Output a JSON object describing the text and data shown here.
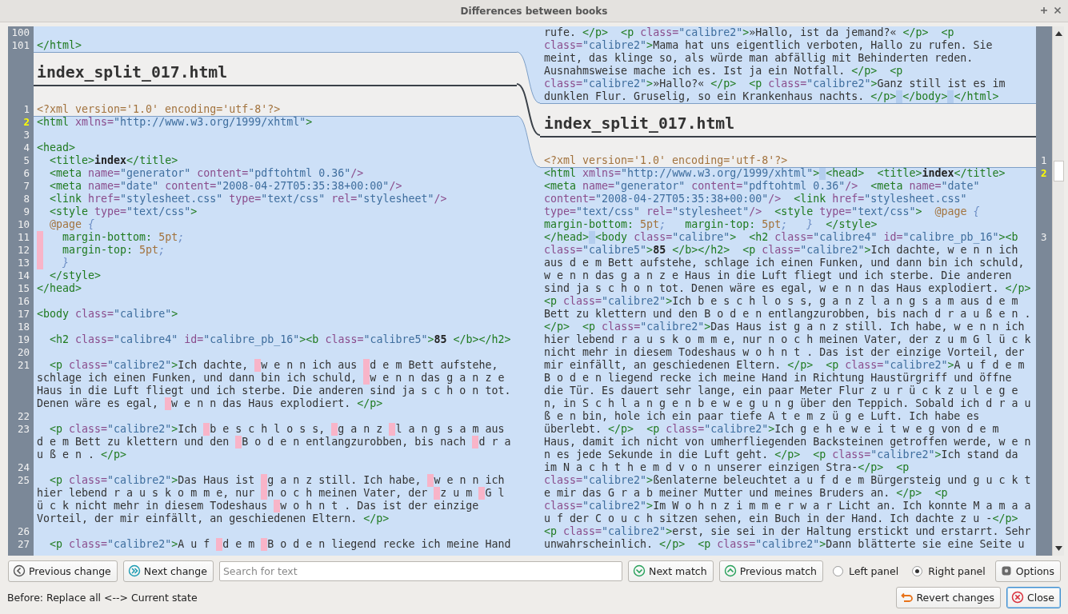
{
  "window": {
    "title": "Differences between books"
  },
  "left_panel": {
    "rows": [
      {
        "kind": "code",
        "number": "100",
        "current": false,
        "in_change": true
      },
      {
        "kind": "code",
        "number": "101",
        "current": false,
        "in_change": true,
        "segments": [
          {
            "text": "</html>",
            "changed": false
          }
        ]
      },
      {
        "kind": "file_header",
        "title": "index_split_017.html"
      },
      {
        "kind": "code",
        "number": "1",
        "current": false,
        "in_change": false,
        "segments": [
          {
            "text": "<?xml version='1.0' encoding='utf-8'?>",
            "changed": false
          }
        ]
      },
      {
        "kind": "code",
        "number": "2",
        "current": true,
        "in_change": true,
        "segments": [
          {
            "text": "<html xmlns=\"http://www.w3.org/1999/xhtml\">",
            "changed": false
          }
        ]
      },
      {
        "kind": "code",
        "number": "3",
        "current": false,
        "in_change": true
      },
      {
        "kind": "code",
        "number": "4",
        "current": false,
        "in_change": true,
        "segments": [
          {
            "text": "<head>",
            "changed": false
          }
        ]
      },
      {
        "kind": "code",
        "number": "5",
        "current": false,
        "in_change": true,
        "segments": [
          {
            "text": "  <title>**index**</title>",
            "changed": false
          }
        ]
      },
      {
        "kind": "code",
        "number": "6",
        "current": false,
        "in_change": true,
        "segments": [
          {
            "text": "  <meta name=\"generator\" content=\"pdftohtml 0.36\"/>",
            "changed": false
          }
        ]
      },
      {
        "kind": "code",
        "number": "7",
        "current": false,
        "in_change": true,
        "segments": [
          {
            "text": "  <meta name=\"date\" content=\"2008-04-27T05:35:38+00:00\"/>",
            "changed": false
          }
        ]
      },
      {
        "kind": "code",
        "number": "8",
        "current": false,
        "in_change": true,
        "segments": [
          {
            "text": "  <link href=\"stylesheet.css\" type=\"text/css\" rel=\"stylesheet\"/>",
            "changed": false
          }
        ]
      },
      {
        "kind": "code",
        "number": "9",
        "current": false,
        "in_change": true,
        "segments": [
          {
            "text": "  <style type=\"text/css\">",
            "changed": false
          }
        ]
      },
      {
        "kind": "code",
        "number": "10",
        "current": false,
        "in_change": true,
        "segments": [
          {
            "text": "  @page {",
            "changed": false
          }
        ]
      },
      {
        "kind": "code",
        "number": "11",
        "current": false,
        "in_change": true,
        "segments": [
          {
            "changed": true
          },
          {
            "text": "   margin-bottom: 5pt;",
            "changed": false
          }
        ]
      },
      {
        "kind": "code",
        "number": "12",
        "current": false,
        "in_change": true,
        "segments": [
          {
            "changed": true
          },
          {
            "text": "   margin-top: 5pt;",
            "changed": false
          }
        ]
      },
      {
        "kind": "code",
        "number": "13",
        "current": false,
        "in_change": true,
        "segments": [
          {
            "changed": true
          },
          {
            "text": "   }",
            "changed": false
          }
        ]
      },
      {
        "kind": "code",
        "number": "14",
        "current": false,
        "in_change": true,
        "segments": [
          {
            "text": "  </style>",
            "changed": false
          }
        ]
      },
      {
        "kind": "code",
        "number": "15",
        "current": false,
        "in_change": true,
        "segments": [
          {
            "text": "</head>",
            "changed": false
          }
        ]
      },
      {
        "kind": "code",
        "number": "16",
        "current": false,
        "in_change": true
      },
      {
        "kind": "code",
        "number": "17",
        "current": false,
        "in_change": true,
        "segments": [
          {
            "text": "<body class=\"calibre\">",
            "changed": false
          }
        ]
      },
      {
        "kind": "code",
        "number": "18",
        "current": false,
        "in_change": true
      },
      {
        "kind": "code",
        "number": "19",
        "current": false,
        "in_change": true,
        "segments": [
          {
            "text": "  <h2 class=\"calibre4\" id=\"calibre_pb_16\"><b class=\"calibre5\">**85** </b></h2>",
            "changed": false
          }
        ]
      },
      {
        "kind": "code",
        "number": "20",
        "current": false,
        "in_change": true
      },
      {
        "kind": "code",
        "number": "21",
        "current": false,
        "in_change": true,
        "segments": [
          {
            "text": "  <p class=\"calibre2\">Ich dachte, ",
            "changed": false
          },
          {
            "changed": true
          },
          {
            "text": "w e n n ich aus ",
            "changed": false
          },
          {
            "changed": true
          },
          {
            "text": "d e m Bett aufstehe, schlage ich einen Funken, und dann bin ich schuld, ",
            "changed": false
          },
          {
            "changed": true
          },
          {
            "text": "w e n n das g a n z e Haus in die Luft fliegt und ich sterbe. Die anderen sind ja s c h o n tot. Denen wäre es egal, ",
            "changed": false
          },
          {
            "changed": true
          },
          {
            "text": "w e n n das Haus explodiert. </p>",
            "changed": false
          }
        ]
      },
      {
        "kind": "code",
        "number": "22",
        "current": false,
        "in_change": true
      },
      {
        "kind": "code",
        "number": "23",
        "current": false,
        "in_change": true,
        "segments": [
          {
            "text": "  <p class=\"calibre2\">Ich ",
            "changed": false
          },
          {
            "changed": true
          },
          {
            "text": "b e s c h l o s s, ",
            "changed": false
          },
          {
            "changed": true
          },
          {
            "text": "g a n z ",
            "changed": false
          },
          {
            "changed": true
          },
          {
            "text": "l a n g s a m aus d e m Bett zu klettern und den ",
            "changed": false
          },
          {
            "changed": true
          },
          {
            "text": "B o d e n entlangzurobben, bis nach ",
            "changed": false
          },
          {
            "changed": true
          },
          {
            "text": "d r a ",
            "changed": false
          },
          {
            "text": "u ß e n . </p>",
            "changed": false
          }
        ]
      },
      {
        "kind": "code",
        "number": "24",
        "current": false,
        "in_change": true
      },
      {
        "kind": "code",
        "number": "25",
        "current": false,
        "in_change": true,
        "segments": [
          {
            "text": "  <p class=\"calibre2\">Das Haus ist ",
            "changed": false
          },
          {
            "changed": true
          },
          {
            "text": "g a n z still. Ich habe, ",
            "changed": false
          },
          {
            "changed": true
          },
          {
            "text": "w e n n ich hier lebend r a u s k o m m e, nur ",
            "changed": false
          },
          {
            "changed": true
          },
          {
            "text": "n o c h meinen Vater, der ",
            "changed": false
          },
          {
            "changed": true
          },
          {
            "text": "z u m ",
            "changed": false
          },
          {
            "changed": true
          },
          {
            "text": "G l ü c k nicht mehr in diesem Todeshaus ",
            "changed": false
          },
          {
            "changed": true
          },
          {
            "text": "w o h n t . Das ist der einzige Vorteil, der mir einfällt, an geschiedenen Eltern. </p>",
            "changed": false
          }
        ]
      },
      {
        "kind": "code",
        "number": "26",
        "current": false,
        "in_change": true
      },
      {
        "kind": "code",
        "number": "27",
        "current": false,
        "in_change": true,
        "segments": [
          {
            "text": "  <p class=\"calibre2\">A u f ",
            "changed": false
          },
          {
            "changed": true
          },
          {
            "text": "d e m ",
            "changed": false
          },
          {
            "changed": true
          },
          {
            "text": "B o d e n liegend recke ich meine Hand",
            "changed": false
          }
        ]
      }
    ]
  },
  "right_panel": {
    "rows": [
      {
        "kind": "code",
        "in_change": true,
        "segments": [
          {
            "text": "rufe. </p>  <p class=\"calibre2\">»Hallo, ist da jemand?« </p>  <p class=\"calibre2\">Mama hat uns eigentlich verboten, Hallo zu rufen. Sie meint, das klinge so, als würde man abfällig mit Behinderten reden. Ausnahmsweise mache ich es. Ist ja ein Notfall. </p>  <p class=\"calibre2\">»Hallo?« </p>  <p class=\"calibre2\">Ganz still ist es im dunklen Flur. Gruselig, so ein Krankenhaus nachts. </p>",
            "changed": false
          },
          {
            "changed": true
          },
          {
            "text": "</body>",
            "changed": false
          },
          {
            "changed": true
          },
          {
            "text": "</html>",
            "changed": false
          }
        ]
      },
      {
        "kind": "file_header",
        "title": "index_split_017.html"
      },
      {
        "kind": "code",
        "number": "1",
        "current": false,
        "in_change": false,
        "segments": [
          {
            "text": "<?xml version='1.0' encoding='utf-8'?>",
            "changed": false
          }
        ]
      },
      {
        "kind": "code",
        "number": "2",
        "current": true,
        "in_change": true,
        "segments": [
          {
            "text": "<html xmlns=\"http://www.w3.org/1999/xhtml\">",
            "changed": false
          },
          {
            "changed": true
          },
          {
            "text": "<head>  <title>**index**</title>  <meta name=\"generator\" content=\"pdftohtml 0.36\"/>  <meta name=\"date\" content=\"2008-04-27T05:35:38+00:00\"/>  <link href=\"stylesheet.css\" type=\"text/css\" rel=\"stylesheet\"/>  <style type=\"text/css\">  @page {   margin-bottom: 5pt;   margin-top: 5pt;   }  </style>",
            "changed": false
          }
        ]
      },
      {
        "kind": "code",
        "number": "3",
        "current": false,
        "in_change": true,
        "segments": [
          {
            "text": "</head>",
            "changed": false
          },
          {
            "changed": true
          },
          {
            "text": "<body class=\"calibre\">  <h2 class=\"calibre4\" id=\"calibre_pb_16\"><b class=\"calibre5\">**85** </b></h2>  <p class=\"calibre2\">Ich dachte, w e n n ich aus d e m Bett aufstehe, schlage ich einen Funken, und dann bin ich schuld, w e n n das g a n z e Haus in die Luft fliegt und ich sterbe. Die anderen sind ja s c h o n tot. Denen wäre es egal, w e n n das Haus explodiert. </p>  <p class=\"calibre2\">Ich b e s c h l o s s, g a n z l a n g s a m aus d e m Bett zu klettern und den B o d e n entlangzurobben, bis nach d r a u ß e n . </p>  <p class=\"calibre2\">Das Haus ist g a n z still. Ich habe, w e n n ich hier lebend r a u s k o m m e, nur n o c h meinen Vater, der z u m G l ü c k nicht mehr in diesem Todeshaus w o h n t . Das ist der einzige Vorteil, der mir einfällt, an geschiedenen Eltern. </p>  <p class=\"calibre2\">A u f d e m B o d e n liegend recke ich meine Hand in Richtung Haustürgriff und öffne die Tür. Es dauert sehr lange, ein paar Meter Flur z u r ü c k z u l e g e n, in S c h l a n g e n b e w e g u n g über den Teppich. Sobald ich d r a u ß e n bin, hole ich ein paar tiefe A t e m z ü g e Luft. Ich habe es überlebt. </p>  <p class=\"calibre2\">Ich g e h e w e i t w e g von d e m Haus, damit ich nicht von umherfliegenden Backsteinen getroffen werde, w e n n es jede Sekunde in die Luft geht. </p>  <p class=\"calibre2\">Ich stand da im N a c h t h e m d v o n unserer einzigen Stra-</p>  <p class=\"calibre2\">ßenlaterne beleuchtet a u f d e m Bürgersteig und g u c k t e mir das G r a b meiner Mutter und meines Bruders an. </p>  <p class=\"calibre2\">Im W o h n z i m m e r w a r Licht an. Ich konnte M a m a a u f der C o u c h sitzen sehen, ein Buch in der Hand. Ich dachte z u -</p>  <p class=\"calibre2\">erst, sie sei in der Haltung erstickt und erstarrt. Sehr unwahrscheinlich. </p>  <p class=\"calibre2\">Dann blätterte sie eine Seite u",
            "changed": false
          }
        ]
      }
    ]
  },
  "toolbar": {
    "buttons": [
      {
        "kind": "previous_change",
        "label": "Previous change"
      },
      {
        "kind": "next_change",
        "label": "Next change"
      },
      {
        "kind": "search",
        "placeholder": "Search for text"
      },
      {
        "kind": "next_match",
        "label": "Next match"
      },
      {
        "kind": "previous_match",
        "label": "Previous match"
      },
      {
        "kind": "radio",
        "label": "Left panel",
        "selected": false
      },
      {
        "kind": "radio",
        "label": "Right panel",
        "selected": true
      },
      {
        "kind": "options",
        "label": "Options"
      }
    ]
  },
  "status_bar": {
    "text": "Before: Replace all <--> Current state",
    "buttons": [
      {
        "kind": "revert",
        "label": "Revert changes",
        "default": false
      },
      {
        "kind": "close",
        "label": "Close",
        "default": true
      }
    ]
  }
}
